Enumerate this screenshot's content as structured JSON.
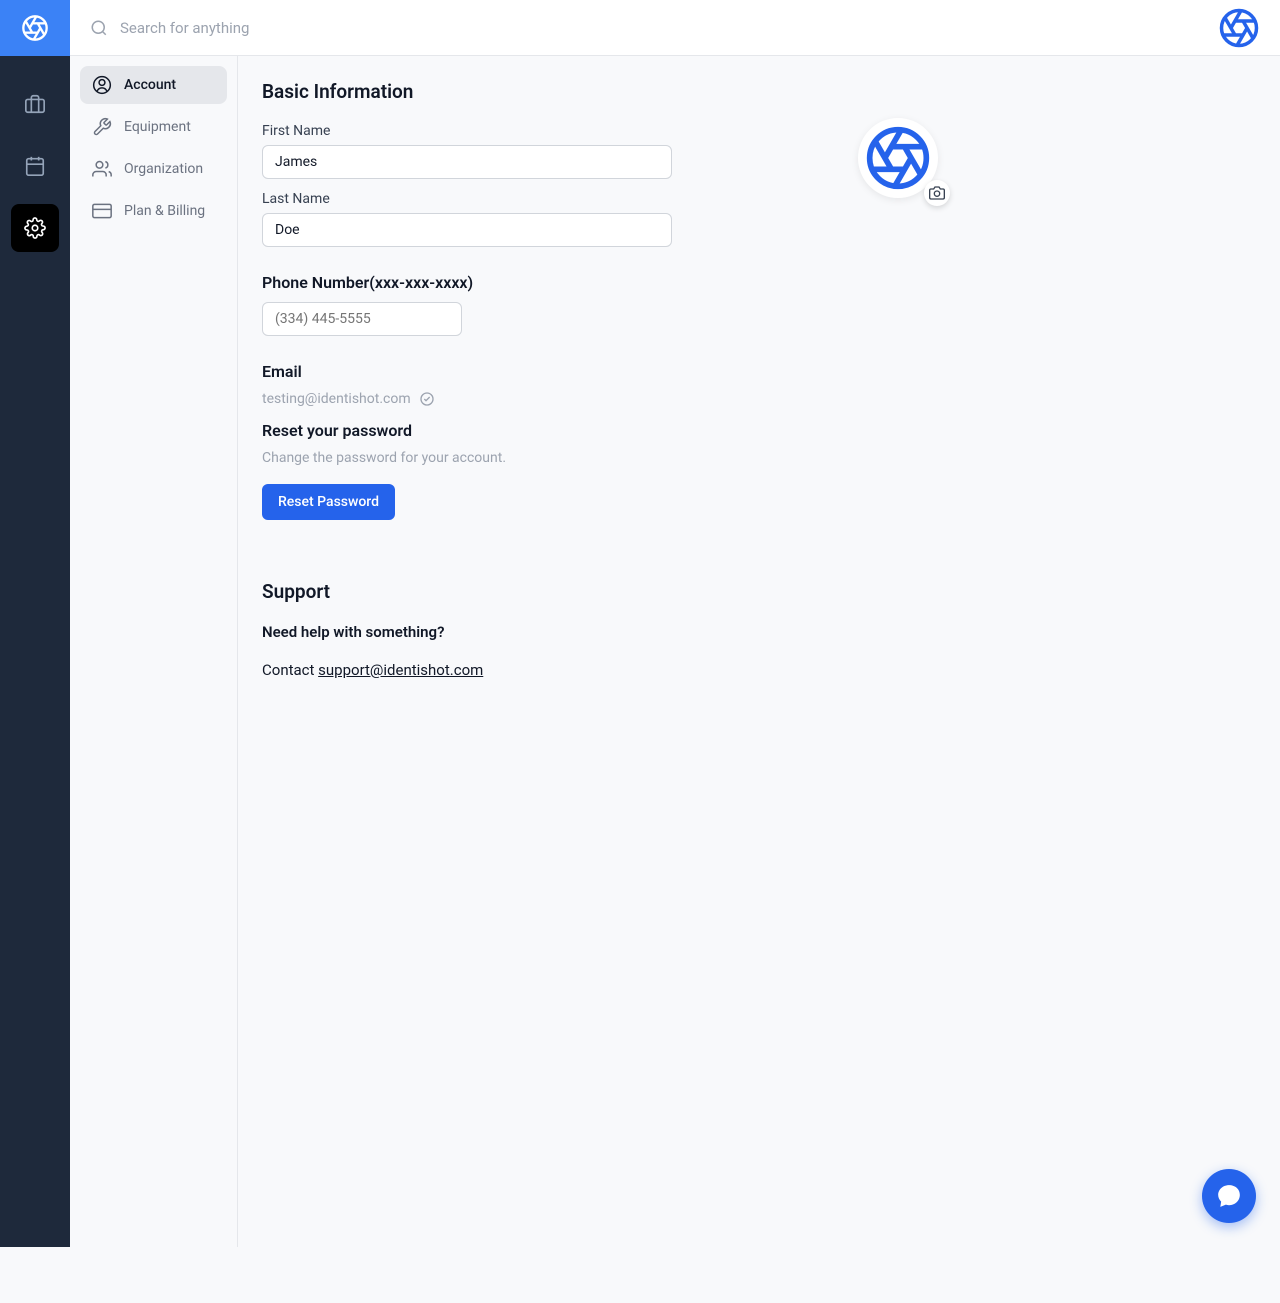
{
  "header": {
    "search_placeholder": "Search for anything"
  },
  "sidebar": {
    "items": [
      {
        "label": "Account"
      },
      {
        "label": "Equipment"
      },
      {
        "label": "Organization"
      },
      {
        "label": "Plan & Billing"
      }
    ]
  },
  "basic_info": {
    "title": "Basic Information",
    "first_name_label": "First Name",
    "first_name_value": "James",
    "last_name_label": "Last Name",
    "last_name_value": "Doe",
    "phone_label": "Phone Number(xxx-xxx-xxxx)",
    "phone_placeholder": "(334) 445-5555",
    "email_label": "Email",
    "email_value": "testing@identishot.com"
  },
  "password": {
    "title": "Reset your password",
    "subtitle": "Change the password for your account.",
    "button": "Reset Password"
  },
  "support": {
    "title": "Support",
    "question": "Need help with something?",
    "contact_prefix": "Contact ",
    "contact_email": "support@identishot.com"
  }
}
